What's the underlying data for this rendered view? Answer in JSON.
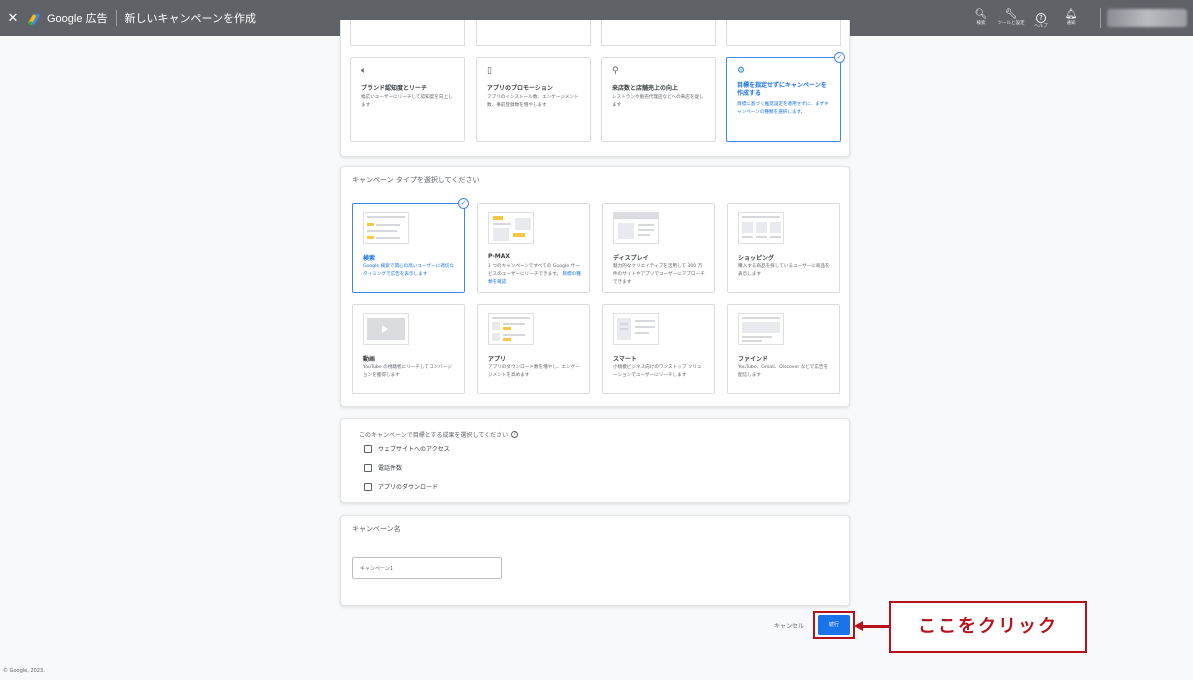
{
  "topbar": {
    "close_glyph": "✕",
    "brand": "Google 広告",
    "title": "新しいキャンペーンを作成",
    "icons": [
      {
        "name": "search-icon",
        "glyph": "🔍︎",
        "label": "検索"
      },
      {
        "name": "tools-icon",
        "glyph": "🔧︎",
        "label": "ツールと設定"
      },
      {
        "name": "help-icon",
        "glyph": "?",
        "label": "ヘルプ"
      },
      {
        "name": "bell-icon",
        "glyph": "🔔︎",
        "label": "通知"
      }
    ]
  },
  "objectives": [
    {
      "icon": "speaker-icon",
      "glyph": "🔈︎",
      "title": "ブランド認知度とリーチ",
      "desc": "幅広いユーザーにリーチして認知度を向上します",
      "selected": false
    },
    {
      "icon": "phone-icon",
      "glyph": "▯",
      "title": "アプリのプロモーション",
      "desc": "アプリのインストール数、エンゲージメント数、事前登録数を増やします",
      "selected": false
    },
    {
      "icon": "pin-icon",
      "glyph": "⚲",
      "title": "来店数と店舗売上の向上",
      "desc": "レストランや販売代理店などへの来店を促します",
      "selected": false
    },
    {
      "icon": "gear-icon",
      "glyph": "⚙",
      "title": "目標を指定せずにキャンペーンを作成する",
      "desc": "目標に基づく推奨設定を適用せずに、まずキャンペーンの種類を選択します。",
      "selected": true
    }
  ],
  "campaign_type": {
    "heading": "キャンペーン タイプを選択してください",
    "items": [
      {
        "title": "検索",
        "desc": "Google 検索で関心の高いユーザーに適切なタイミングで広告を表示します",
        "selected": true
      },
      {
        "title": "P-MAX",
        "desc": "1 つのキャンペーンですべての Google サービスのユーザーにリーチできます。",
        "link": "目標の種類を確認",
        "selected": false
      },
      {
        "title": "ディスプレイ",
        "desc": "魅力的なクリエイティブを活用して 300 万件のサイトやアプリでユーザーにアプローチできます",
        "selected": false
      },
      {
        "title": "ショッピング",
        "desc": "購入する商品を探しているユーザーに商品を表示します",
        "selected": false
      },
      {
        "title": "動画",
        "desc": "YouTube の視聴者にリーチしてコンバージョンを獲得します",
        "selected": false
      },
      {
        "title": "アプリ",
        "desc": "アプリのダウンロード数を増やし、エンゲージメントを高めます",
        "selected": false
      },
      {
        "title": "スマート",
        "desc": "小規模ビジネス向けのワンストップ ソリューションでユーザーにリーチします",
        "selected": false
      },
      {
        "title": "ファインド",
        "desc": "YouTube、Gmail、Discover などで広告を配信します",
        "selected": false
      }
    ]
  },
  "goals": {
    "heading": "このキャンペーンで目標とする成果を選択してください",
    "options": [
      {
        "label": "ウェブサイトへのアクセス"
      },
      {
        "label": "電話件数"
      },
      {
        "label": "アプリのダウンロード"
      }
    ]
  },
  "campaign_name": {
    "heading": "キャンペーン名",
    "value": "キャンペーン1"
  },
  "actions": {
    "cancel": "キャンセル",
    "continue": "続行"
  },
  "annotation": {
    "callout": "ここをクリック",
    "color": "#b5121b"
  },
  "footer": {
    "copyright": "© Google, 2023."
  }
}
